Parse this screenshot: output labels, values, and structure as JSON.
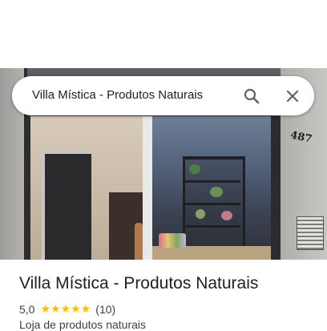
{
  "search": {
    "query": "Villa Mística - Produtos Naturais",
    "search_icon": "search-icon",
    "close_icon": "close-icon"
  },
  "photo": {
    "house_number": "487"
  },
  "place": {
    "name": "Villa Mística - Produtos Naturais",
    "rating": "5,0",
    "stars": 5,
    "review_count": "(10)",
    "category": "Loja de produtos naturais"
  },
  "colors": {
    "star": "#fbbc04",
    "text": "#202124",
    "secondary_text": "#3c4043"
  }
}
